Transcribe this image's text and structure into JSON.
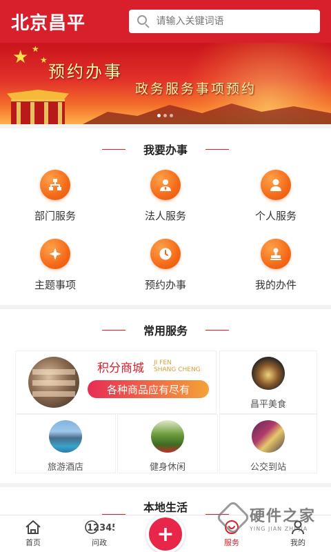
{
  "header": {
    "logo": "北京昌平",
    "search_placeholder": "请输入关键词语",
    "search_icon": "search-icon"
  },
  "banner": {
    "title": "预约办事",
    "subtitle": "政务服务事项预约"
  },
  "sections": {
    "work": {
      "title": "我要办事",
      "items": [
        {
          "label": "部门服务",
          "icon": "org-chart-icon"
        },
        {
          "label": "法人服务",
          "icon": "legal-person-icon"
        },
        {
          "label": "个人服务",
          "icon": "person-icon"
        },
        {
          "label": "主题事项",
          "icon": "topic-icon"
        },
        {
          "label": "预约办事",
          "icon": "clock-icon"
        },
        {
          "label": "我的办件",
          "icon": "stamp-icon"
        }
      ]
    },
    "common": {
      "title": "常用服务",
      "promo": {
        "title": "积分商城",
        "subtitle_en_1": "JI FEN",
        "subtitle_en_2": "SHANG CHENG",
        "tagline": "各种商品应有尽有"
      },
      "items": [
        {
          "label": "昌平美食"
        },
        {
          "label": "旅游酒店"
        },
        {
          "label": "健身休闲"
        },
        {
          "label": "公交到站"
        }
      ]
    },
    "local": {
      "title": "本地生活"
    }
  },
  "bottom_nav": {
    "items": [
      {
        "label": "首页",
        "icon": "home-icon"
      },
      {
        "label": "问政",
        "icon": "hotline-12345-icon",
        "badge": "12345"
      },
      {
        "label": "",
        "icon": "plus-icon"
      },
      {
        "label": "服务",
        "icon": "service-icon"
      },
      {
        "label": "我的",
        "icon": "user-icon"
      }
    ],
    "active_label": "服务"
  },
  "watermark": {
    "cn": "硬件之家",
    "en": "YING JIAN ZHI JIA"
  },
  "colors": {
    "brand_red": "#d8202c",
    "icon_orange": "#f46a18",
    "plus_red": "#e8264a"
  }
}
